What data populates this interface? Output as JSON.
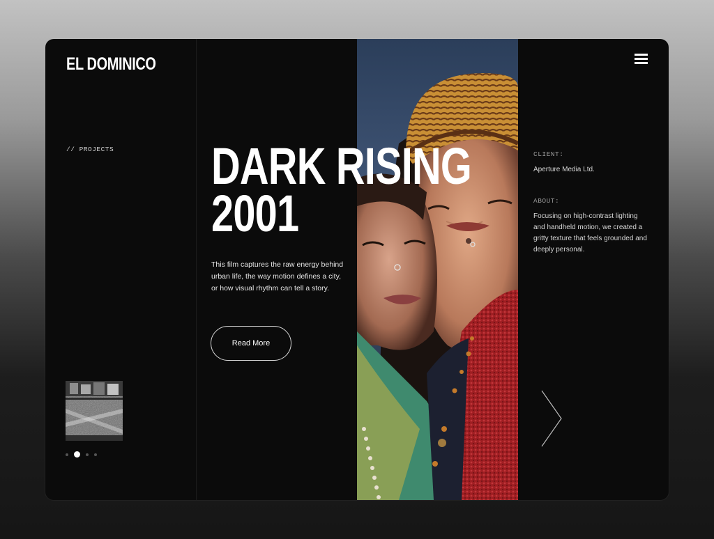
{
  "brand": {
    "logo": "EL DOMINICO"
  },
  "nav": {
    "menu_icon": "hamburger-menu-icon"
  },
  "sidebar": {
    "section_label": "// PROJECTS",
    "slider": {
      "total": 4,
      "active_index": 1
    }
  },
  "hero": {
    "title_line1": "DARK RISING",
    "title_line2": "2001",
    "description": "This film captures the raw energy behind urban life, the way motion defines a city, or how visual rhythm can tell a story.",
    "cta_label": "Read More"
  },
  "details": {
    "client_label": "CLIENT:",
    "client_value": "Aperture Media Ltd.",
    "about_label": "ABOUT:",
    "about_value": "Focusing on high-contrast lighting and handheld motion, we created a gritty texture that feels grounded and deeply personal."
  },
  "icons": {
    "next": "chevron-right-icon"
  },
  "colors": {
    "background": "#0b0b0b",
    "text": "#ffffff",
    "muted": "#9a9a9a"
  }
}
